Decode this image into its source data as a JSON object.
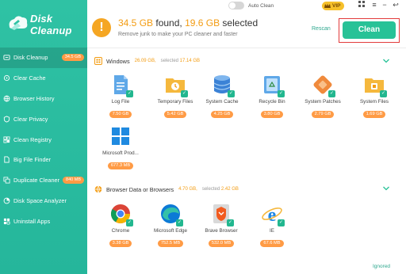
{
  "app": {
    "name_line1": "Disk",
    "name_line2": "Cleanup"
  },
  "sidebar": {
    "items": [
      {
        "label": "Disk Cleanup",
        "badge": "34.5 GB",
        "active": true
      },
      {
        "label": "Clear Cache"
      },
      {
        "label": "Browser History"
      },
      {
        "label": "Clear Privacy"
      },
      {
        "label": "Clean Registry"
      },
      {
        "label": "Big File Finder"
      },
      {
        "label": "Duplicate Cleaner",
        "badge": "840 MB"
      },
      {
        "label": "Disk Space Analyzer"
      },
      {
        "label": "Uninstall Apps"
      }
    ]
  },
  "header": {
    "auto_clean_label": "Auto Clean",
    "vip_label": "VIP",
    "found_prefix": "34.5 GB",
    "found_mid": " found, ",
    "selected_amount": "19.6 GB",
    "selected_suffix": " selected",
    "subtitle": "Remove junk to make your PC cleaner and faster",
    "rescan_label": "Rescan",
    "clean_label": "Clean"
  },
  "sections": {
    "windows": {
      "title": "Windows",
      "size": "26.09 GB,",
      "selected_label": "selected",
      "selected_value": "17.14 GB",
      "items": [
        {
          "label": "Log File",
          "size": "7.50 GB"
        },
        {
          "label": "Temporary Files",
          "size": "5.42 GB"
        },
        {
          "label": "System Cache",
          "size": "4.25 GB"
        },
        {
          "label": "Recycle Bin",
          "size": "3.80 GB"
        },
        {
          "label": "System Patches",
          "size": "2.79 GB"
        },
        {
          "label": "System Files",
          "size": "1.69 GB"
        },
        {
          "label": "Microsoft Prod...",
          "size": "677.3 MB"
        }
      ]
    },
    "browsers": {
      "title": "Browser Data or Browsers",
      "size": "4.70 GB,",
      "selected_label": "selected",
      "selected_value": "2.42 GB",
      "items": [
        {
          "label": "Chrome",
          "size": "3.38 GB"
        },
        {
          "label": "Microsoft Edge",
          "size": "752.5 MB"
        },
        {
          "label": "Brave Browser",
          "size": "532.0 MB"
        },
        {
          "label": "IE",
          "size": "67.6 MB"
        }
      ]
    }
  },
  "footer": {
    "ignored_label": "Ignored"
  },
  "colors": {
    "accent": "#27c297",
    "sidebar": "#2fc2a4",
    "warning": "#f39c12",
    "badge": "#ff9b45",
    "highlight_border": "#e23b3b"
  }
}
